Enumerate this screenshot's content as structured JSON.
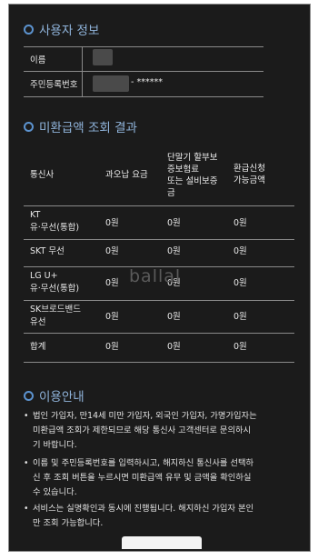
{
  "user_info": {
    "title": "사용자 정보",
    "name_label": "이름",
    "rrn_label": "주민등록번호",
    "rrn_suffix": "- ******"
  },
  "result": {
    "title": "미환급액 조회 결과",
    "headers": [
      "통신사",
      "과오납 요금",
      "단말기 할부보증보험료 또는 설비보증금",
      "환급신청 가능금액"
    ],
    "header_lines": {
      "carrier": "통신사",
      "overpaid": "과오납 요금",
      "device_l1": "단말기 할부보",
      "device_l2": "증보험료",
      "device_l3": "또는 설비보증",
      "device_l4": "금",
      "refund_l1": "환급신청",
      "refund_l2": "가능금액"
    },
    "rows": [
      {
        "carrier_l1": "KT",
        "carrier_l2": "유·무선(통합)",
        "overpaid": "0원",
        "device": "0원",
        "refund": "0원"
      },
      {
        "carrier_l1": "SKT 무선",
        "carrier_l2": "",
        "overpaid": "0원",
        "device": "0원",
        "refund": "0원"
      },
      {
        "carrier_l1": "LG U+",
        "carrier_l2": "유·무선(통합)",
        "overpaid": "0원",
        "device": "0원",
        "refund": "0원"
      },
      {
        "carrier_l1": "SK브로드밴드",
        "carrier_l2": "유선",
        "overpaid": "0원",
        "device": "0원",
        "refund": "0원"
      },
      {
        "carrier_l1": "합계",
        "carrier_l2": "",
        "overpaid": "0원",
        "device": "0원",
        "refund": "0원"
      }
    ],
    "watermark": "ballal"
  },
  "guide": {
    "title": "이용안내",
    "items": [
      {
        "line1": "법인 가입자, 만14세 미만 가입자, 외국인 가입자, 가명가입자는",
        "line2": "미환급액 조회가 제한되므로 해당 통신사 고객센터로 문의하시",
        "line3": "기 바랍니다."
      },
      {
        "line1": "이름 및 주민등록번호를 입력하시고, 해지하신 통신사를 선택하",
        "line2": "신 후 조회 버튼을 누르시면 미환급액 유무 및 금액을 확인하실",
        "line3": "수 있습니다."
      },
      {
        "line1": "서비스는 실명확인과 동시에 진행됩니다. 해지하신 가입자 본인",
        "line2": "만 조회 가능합니다.",
        "line3": ""
      }
    ],
    "bullet": "•"
  }
}
